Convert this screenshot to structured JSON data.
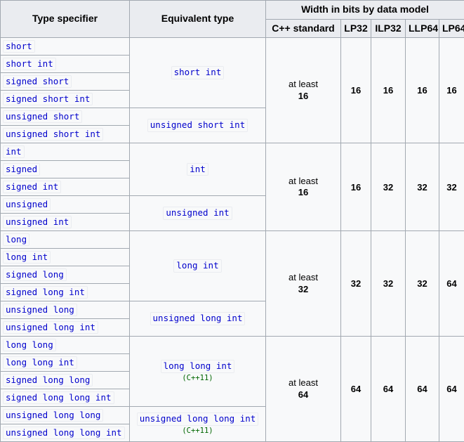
{
  "table": {
    "headers": {
      "type_specifier": "Type specifier",
      "equivalent_type": "Equivalent type",
      "width_group": "Width in bits by data model",
      "cpp_standard": "C++ standard",
      "lp32": "LP32",
      "ilp32": "ILP32",
      "llp64": "LLP64",
      "lp64": "LP64"
    },
    "colors": {
      "code_text": "#0000cc",
      "code_background": "#f8f9fa",
      "code_border": "#eaecf0",
      "since_tag": "#006600",
      "cell_border": "#a2a9b1",
      "header_background": "#eaecf0",
      "cell_background": "#f8f9fa"
    },
    "specifiers": [
      "short",
      "short int",
      "signed short",
      "signed short int",
      "unsigned short",
      "unsigned short int",
      "int",
      "signed",
      "signed int",
      "unsigned",
      "unsigned int",
      "long",
      "long int",
      "signed long",
      "signed long int",
      "unsigned long",
      "unsigned long int",
      "long long",
      "long long int",
      "signed long long",
      "signed long long int",
      "unsigned long long",
      "unsigned long long int"
    ],
    "equivalents": [
      {
        "code": "short int",
        "since": ""
      },
      {
        "code": "unsigned short int",
        "since": ""
      },
      {
        "code": "int",
        "since": ""
      },
      {
        "code": "unsigned int",
        "since": ""
      },
      {
        "code": "long int",
        "since": ""
      },
      {
        "code": "unsigned long int",
        "since": ""
      },
      {
        "code": "long long int",
        "since": "(C++11)"
      },
      {
        "code": "unsigned long long int",
        "since": "(C++11)"
      }
    ],
    "widths": [
      {
        "atleast": "at least",
        "bits": "16",
        "lp32": "16",
        "ilp32": "16",
        "llp64": "16",
        "lp64": "16"
      },
      {
        "atleast": "at least",
        "bits": "16",
        "lp32": "16",
        "ilp32": "32",
        "llp64": "32",
        "lp64": "32"
      },
      {
        "atleast": "at least",
        "bits": "32",
        "lp32": "32",
        "ilp32": "32",
        "llp64": "32",
        "lp64": "64"
      },
      {
        "atleast": "at least",
        "bits": "64",
        "lp32": "64",
        "ilp32": "64",
        "llp64": "64",
        "lp64": "64"
      }
    ]
  }
}
